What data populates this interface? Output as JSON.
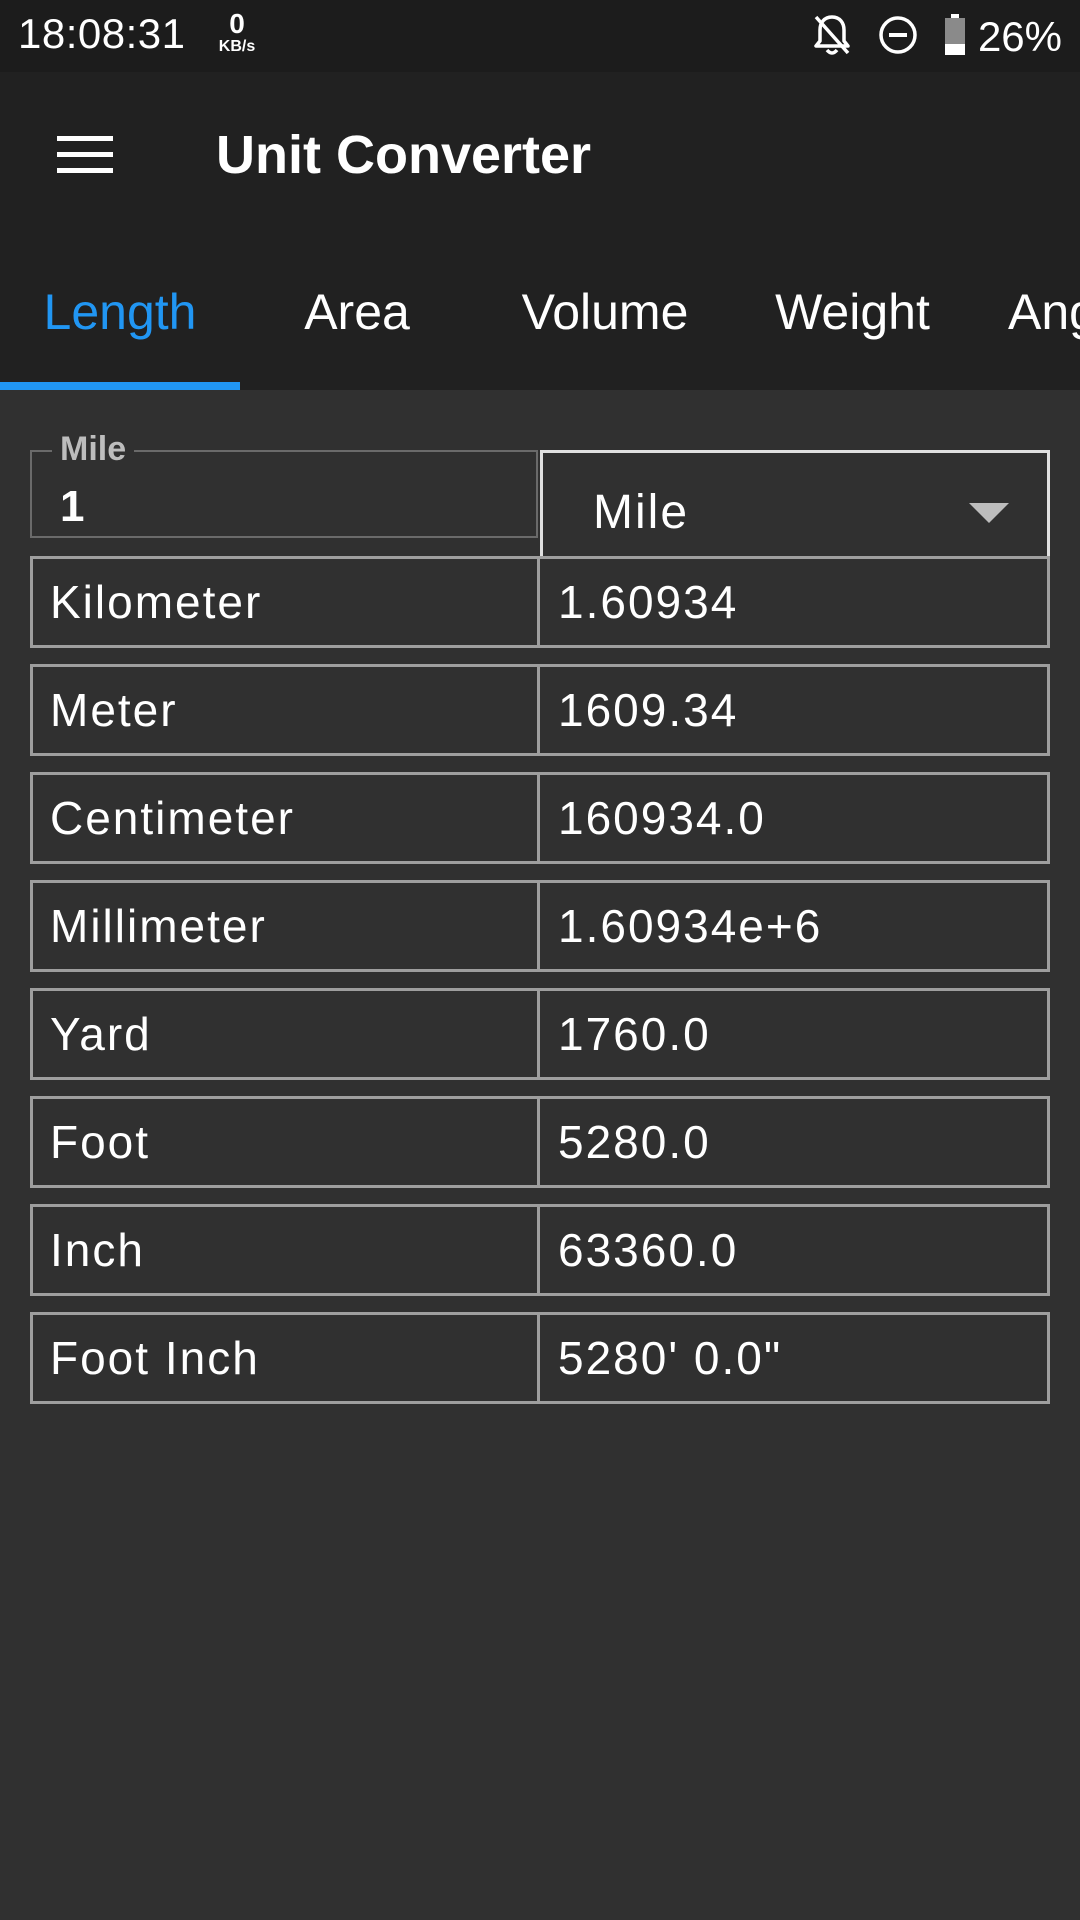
{
  "status_bar": {
    "time": "18:08:31",
    "net_speed_value": "0",
    "net_speed_unit": "KB/s",
    "battery_percent": "26%",
    "icons": [
      "bell-off-icon",
      "do-not-disturb-icon",
      "battery-icon"
    ]
  },
  "app_bar": {
    "title": "Unit Converter",
    "menu_icon": "hamburger-menu-icon"
  },
  "tabs": [
    {
      "label": "Length",
      "active": true
    },
    {
      "label": "Area",
      "active": false
    },
    {
      "label": "Volume",
      "active": false
    },
    {
      "label": "Weight",
      "active": false
    },
    {
      "label": "Ang",
      "active": false
    }
  ],
  "input": {
    "label": "Mile",
    "value": "1"
  },
  "unit_select": {
    "selected": "Mile"
  },
  "results": [
    {
      "name": "Kilometer",
      "value": "1.60934"
    },
    {
      "name": "Meter",
      "value": "1609.34"
    },
    {
      "name": "Centimeter",
      "value": "160934.0"
    },
    {
      "name": "Millimeter",
      "value": "1.60934e+6"
    },
    {
      "name": "Yard",
      "value": "1760.0"
    },
    {
      "name": "Foot",
      "value": "5280.0"
    },
    {
      "name": "Inch",
      "value": "63360.0"
    },
    {
      "name": "Foot Inch",
      "value": "5280' 0.0\""
    }
  ],
  "colors": {
    "accent": "#2196f3",
    "app_bar": "#212121",
    "background": "#303030",
    "border": "#9e9e9e"
  }
}
